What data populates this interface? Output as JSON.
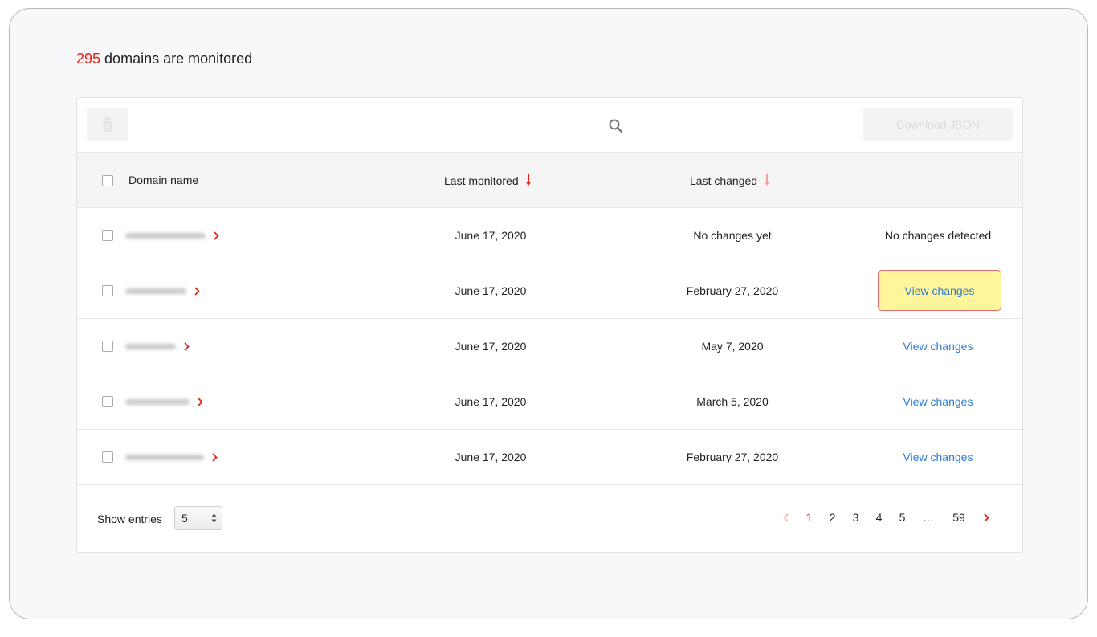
{
  "summary": {
    "count": "295",
    "suffix": " domains are monitored"
  },
  "toolbar": {
    "search_placeholder": "",
    "download_label": "Download JSON"
  },
  "table": {
    "headers": {
      "domain": "Domain name",
      "last_monitored": "Last monitored",
      "last_changed": "Last changed"
    },
    "rows": [
      {
        "last_monitored": "June 17, 2020",
        "last_changed": "No changes yet",
        "action": "No changes detected"
      },
      {
        "last_monitored": "June 17, 2020",
        "last_changed": "February 27, 2020",
        "action": "View changes"
      },
      {
        "last_monitored": "June 17, 2020",
        "last_changed": "May 7, 2020",
        "action": "View changes"
      },
      {
        "last_monitored": "June 17, 2020",
        "last_changed": "March 5, 2020",
        "action": "View changes"
      },
      {
        "last_monitored": "June 17, 2020",
        "last_changed": "February 27, 2020",
        "action": "View changes"
      }
    ]
  },
  "footer": {
    "show_entries_label": "Show entries",
    "entries_value": "5",
    "pages": [
      "1",
      "2",
      "3",
      "4",
      "5",
      "…",
      "59"
    ]
  },
  "colors": {
    "accent_red": "#e2231a",
    "link_blue": "#2b7bd6",
    "highlight_yellow": "#fff59a"
  }
}
